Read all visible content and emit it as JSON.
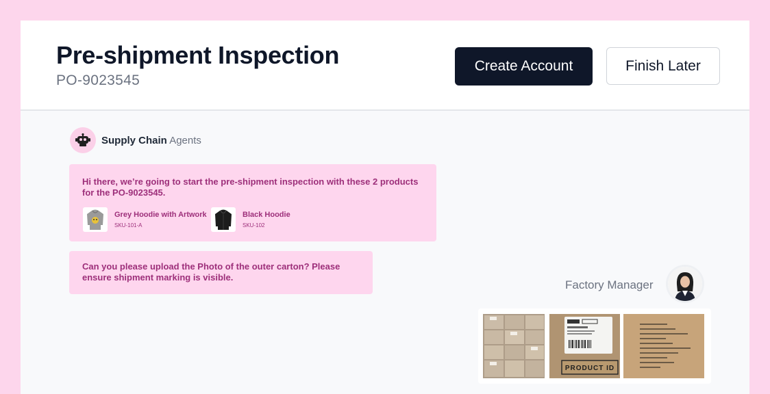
{
  "header": {
    "title": "Pre-shipment Inspection",
    "po_number": "PO-9023545",
    "create_account_label": "Create Account",
    "finish_later_label": "Finish Later"
  },
  "agent": {
    "name_bold": "Supply Chain",
    "name_muted": "Agents",
    "icon": "robot-icon"
  },
  "messages": [
    {
      "text": "Hi there, we’re going to start the pre-shipment inspection with these 2 products for the PO-9023545.",
      "products": [
        {
          "name": "Grey Hoodie with Artwork",
          "sku": "SKU-101-A",
          "icon": "grey-hoodie-icon"
        },
        {
          "name": "Black Hoodie",
          "sku": "SKU-102",
          "icon": "black-hoodie-icon"
        }
      ]
    },
    {
      "text": "Can you please upload the Photo of the outer carton? Please ensure shipment marking is visible."
    }
  ],
  "reply": {
    "sender": "Factory Manager",
    "photos": [
      {
        "label": ""
      },
      {
        "label": "PRODUCT ID"
      },
      {
        "label": ""
      }
    ]
  },
  "colors": {
    "background": "#fdd6ec",
    "bubble": "#fed6ee",
    "bubble_text": "#9d2f7a",
    "primary": "#0f1729"
  }
}
